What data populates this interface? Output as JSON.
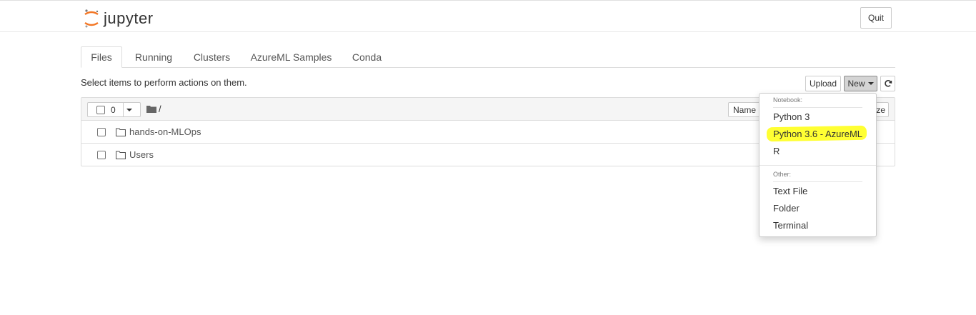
{
  "header": {
    "app_name": "jupyter",
    "quit_label": "Quit"
  },
  "tabs": [
    {
      "label": "Files",
      "active": true
    },
    {
      "label": "Running",
      "active": false
    },
    {
      "label": "Clusters",
      "active": false
    },
    {
      "label": "AzureML Samples",
      "active": false
    },
    {
      "label": "Conda",
      "active": false
    }
  ],
  "toolbar": {
    "hint": "Select items to perform actions on them.",
    "upload_label": "Upload",
    "new_label": "New",
    "refresh_icon": "refresh-icon"
  },
  "file_list": {
    "selected_count": "0",
    "path": "/",
    "sort_name_label": "Name",
    "sort_size_label": "ze",
    "items": [
      {
        "name": "hands-on-MLOps",
        "type": "folder"
      },
      {
        "name": "Users",
        "type": "folder"
      }
    ]
  },
  "new_menu": {
    "notebook_header": "Notebook:",
    "notebooks": [
      "Python 3",
      "Python 3.6 - AzureML",
      "R"
    ],
    "other_header": "Other:",
    "others": [
      "Text File",
      "Folder",
      "Terminal"
    ]
  },
  "colors": {
    "highlight": "#ffff33",
    "jupyter_orange": "#f37726"
  }
}
